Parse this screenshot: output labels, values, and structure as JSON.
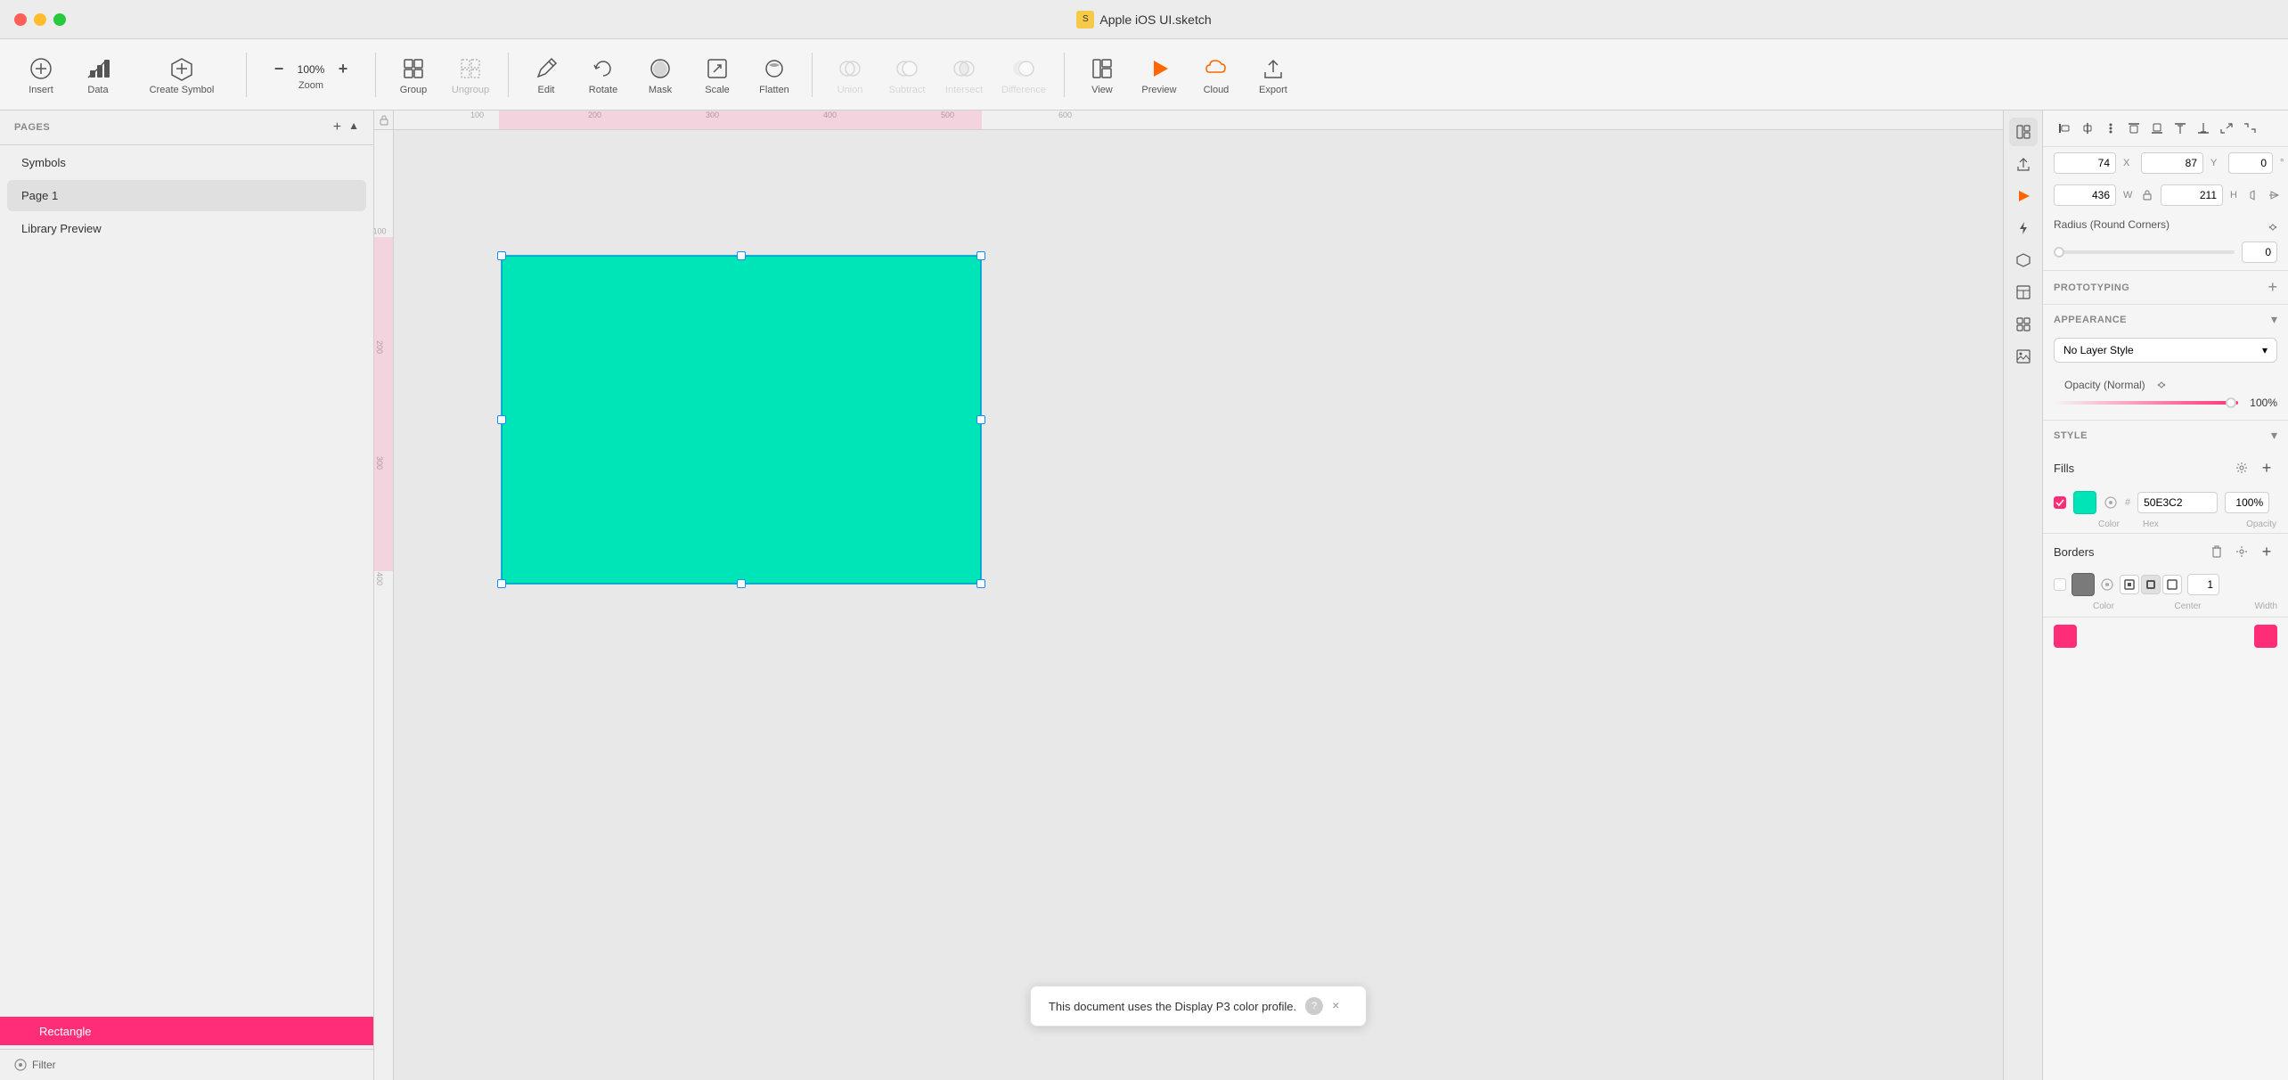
{
  "titlebar": {
    "title": "Apple iOS UI.sketch",
    "app_icon": "⬡"
  },
  "toolbar": {
    "insert_label": "Insert",
    "data_label": "Data",
    "create_symbol_label": "Create Symbol",
    "zoom_label": "Zoom",
    "zoom_value": "100%",
    "group_label": "Group",
    "ungroup_label": "Ungroup",
    "edit_label": "Edit",
    "rotate_label": "Rotate",
    "mask_label": "Mask",
    "scale_label": "Scale",
    "flatten_label": "Flatten",
    "union_label": "Union",
    "subtract_label": "Subtract",
    "intersect_label": "Intersect",
    "difference_label": "Difference",
    "view_label": "View",
    "preview_label": "Preview",
    "cloud_label": "Cloud",
    "export_label": "Export"
  },
  "sidebar": {
    "pages_label": "PAGES",
    "add_label": "+",
    "collapse_label": "▲",
    "pages": [
      {
        "name": "Symbols",
        "active": false
      },
      {
        "name": "Page 1",
        "active": true
      },
      {
        "name": "Library Preview",
        "active": false
      }
    ],
    "layers": [
      {
        "name": "Rectangle",
        "active": true
      }
    ],
    "filter_label": "Filter"
  },
  "canvas": {
    "ruler_marks": [
      "100",
      "200",
      "300",
      "400",
      "500",
      "600"
    ],
    "ruler_marks_v": [
      "100",
      "200",
      "300",
      "400"
    ],
    "notification_text": "This document uses the Display P3 color profile.",
    "notification_help": "?",
    "notification_close": "×"
  },
  "right_panel": {
    "alignment": {
      "buttons": [
        "⊟",
        "⊞",
        "⋮",
        "←",
        "→",
        "↑",
        "↓",
        "⊡",
        "⊞"
      ]
    },
    "transform": {
      "x_label": "X",
      "x_value": "74",
      "y_label": "Y",
      "y_value": "87",
      "rotation_value": "0",
      "rotation_symbol": "°",
      "w_label": "W",
      "w_value": "436",
      "h_label": "H",
      "h_value": "211",
      "lock_icon": "🔒"
    },
    "prototyping": {
      "title": "PROTOTYPING",
      "add_label": "+"
    },
    "appearance": {
      "title": "APPEARANCE",
      "no_layer_style": "No Layer Style",
      "chevron": "▾"
    },
    "opacity": {
      "label": "Opacity (Normal)",
      "value": "100%"
    },
    "style": {
      "title": "STYLE"
    },
    "fills": {
      "title": "Fills",
      "color_label": "Color",
      "hex_label": "Hex",
      "opacity_label": "Opacity",
      "hex_value": "50E3C2",
      "opacity_value": "100%",
      "fill_color": "#00e5b8"
    },
    "borders": {
      "title": "Borders",
      "color_label": "Color",
      "center_label": "Center",
      "width_label": "Width",
      "width_value": "1",
      "border_color": "#7a7a7a"
    }
  },
  "icons": {
    "insert": "+",
    "data": "📊",
    "create_symbol": "⊞",
    "zoom_minus": "−",
    "zoom_plus": "+",
    "group": "▣",
    "ungroup": "□",
    "edit": "✎",
    "rotate": "↺",
    "mask": "⬡",
    "scale": "⤢",
    "flatten": "▽",
    "union": "∪",
    "subtract": "⊖",
    "intersect": "∩",
    "difference": "⊕",
    "view": "▭",
    "preview": "▶",
    "cloud": "☁",
    "export_icon": "⬆",
    "panel_inspector": "◉",
    "panel_export": "⬆",
    "panel_upload": "⬆",
    "panel_forward": "▶",
    "panel_lightning": "⚡",
    "panel_hexagon": "⬡",
    "panel_table": "⊟",
    "panel_grid": "⊞",
    "panel_img": "🖼",
    "filter": "◎",
    "lock": "🔒"
  }
}
